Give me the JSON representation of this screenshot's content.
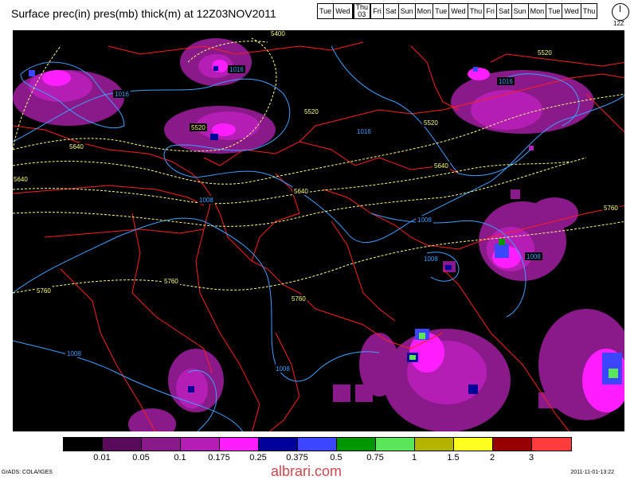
{
  "title": "Surface prec(in) pres(mb) thick(m) at 12Z03NOV2011",
  "days": [
    {
      "label": "Tue"
    },
    {
      "label": "Wed"
    },
    {
      "label": "Thu",
      "sub": "03",
      "selected": true
    },
    {
      "label": "Fri"
    },
    {
      "label": "Sat"
    },
    {
      "label": "Sun"
    },
    {
      "label": "Mon"
    },
    {
      "label": "Tue"
    },
    {
      "label": "Wed"
    },
    {
      "label": "Thu"
    },
    {
      "label": "Fri"
    },
    {
      "label": "Sat"
    },
    {
      "label": "Sun"
    },
    {
      "label": "Mon"
    },
    {
      "label": "Tue"
    },
    {
      "label": "Wed"
    },
    {
      "label": "Thu"
    }
  ],
  "clock_label": "12Z",
  "legend": {
    "colors": [
      "#000000",
      "#5a0a5a",
      "#8a1a8a",
      "#b41eb4",
      "#ff1eff",
      "#00009a",
      "#3c46ff",
      "#009600",
      "#5ae65a",
      "#b4b400",
      "#ffff1e",
      "#960000",
      "#ff3c3c"
    ],
    "labels": [
      "0.01",
      "0.05",
      "0.1",
      "0.175",
      "0.25",
      "0.375",
      "0.5",
      "0.75",
      "1",
      "1.5",
      "2",
      "3"
    ]
  },
  "contour_labels": {
    "isobars": [
      "1016",
      "1016",
      "1016",
      "1016",
      "1008",
      "1008",
      "1008",
      "1008",
      "1008",
      "1008"
    ],
    "thickness": [
      "5400",
      "5520",
      "5520",
      "5520",
      "5520",
      "5640",
      "5640",
      "5640",
      "5640",
      "5760",
      "5760",
      "5760",
      "5760"
    ]
  },
  "colors": {
    "border": "#ff1e1e",
    "isobar": "#3ca0ff",
    "thickness": "#ffff78"
  },
  "footer": {
    "left": "GrADS: COLA/IGES",
    "right": "2011-11-01-13:22"
  },
  "watermark": "albrari.com"
}
